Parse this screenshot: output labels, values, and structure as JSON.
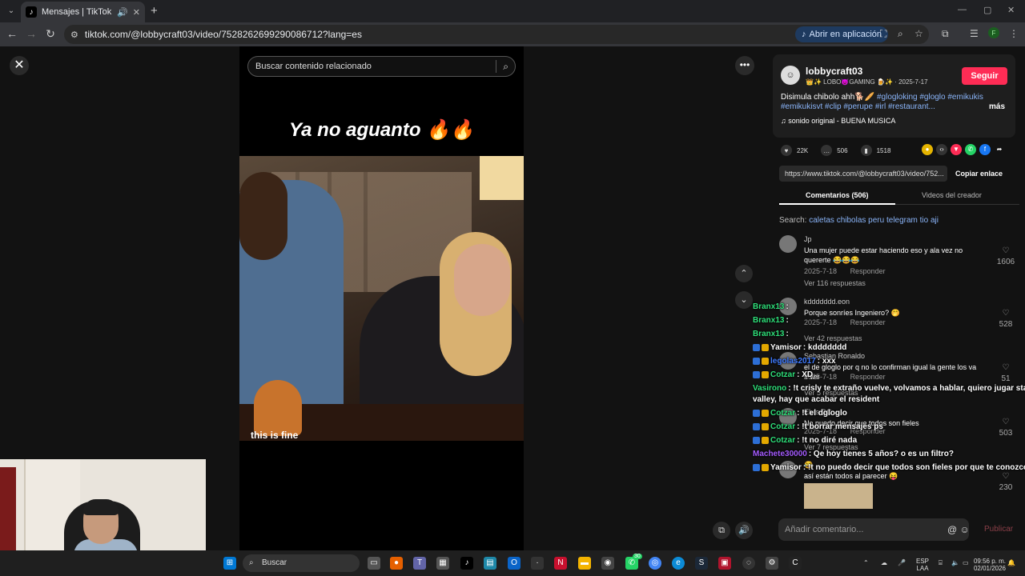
{
  "browser": {
    "tab_title": "Mensajes | TikTok",
    "url": "tiktok.com/@lobbycraft03/video/7528262699290086712?lang=es",
    "open_in_app": "Abrir en aplicación",
    "profile_letter": "F"
  },
  "video": {
    "search_placeholder": "Buscar contenido relacionado",
    "caption": "Ya no aguanto 🔥🔥",
    "meme_text": "this is fine"
  },
  "post": {
    "username": "lobbycraft03",
    "nickname": "👑✨ LOBO😈GAMING 🍺✨",
    "date": "2025-7-17",
    "follow_label": "Seguir",
    "description": "Disimula chibolo ahh🐕🥖",
    "tags": "#glogloking #gloglo #emikukis #emikukisvt #clip #perupe #irl #restaurant...",
    "more_label": "más",
    "sound": "sonido original - BUENA MUSICA",
    "likes": "22K",
    "comments": "506",
    "saves": "1518",
    "link": "https://www.tiktok.com/@lobbycraft03/video/752...",
    "copy_link": "Copiar enlace",
    "tab_comments": "Comentarios (506)",
    "tab_creator": "Videos del creador",
    "search_prefix": "Search:",
    "search_query": "caletas chibolas peru telegram tio aji",
    "add_comment_placeholder": "Añadir comentario...",
    "publish_label": "Publicar"
  },
  "comments": [
    {
      "user": "Jp",
      "text": "Una mujer puede estar haciendo eso y ala vez no quererte 😂😂😂",
      "date": "2025-7-18",
      "reply": "Responder",
      "more": "Ver 116 respuestas",
      "likes": "1606"
    },
    {
      "user": "kddddddd.eon",
      "text": "Porque sonríes Ingeniero? 🤭",
      "date": "2025-7-18",
      "reply": "Responder",
      "more": "Ver 42 respuestas",
      "likes": "528"
    },
    {
      "user": "Sebastian Ronaldo",
      "text": "el de gloglo por q no lo confirman igual la gente los va s ver",
      "date": "2025-7-18",
      "reply": "Responder",
      "more": "Ver 5 respuestas",
      "likes": "51"
    },
    {
      "user": "Elvis DC",
      "text": "No puedo decir que todos son fieles",
      "date": "2025-7-18",
      "reply": "Responder",
      "more": "Ver 7 respuestas",
      "likes": "503"
    },
    {
      "user": "😂",
      "text": "así están todos al parecer 😝",
      "likes": "230"
    }
  ],
  "chat": [
    {
      "name": "Branx13",
      "color": "#2fe07a",
      "text": ":",
      "badges": 0
    },
    {
      "name": "Branx13",
      "color": "#2fe07a",
      "text": ":",
      "badges": 0
    },
    {
      "name": "Branx13",
      "color": "#2fe07a",
      "text": ":",
      "badges": 0
    },
    {
      "name": "Yamisor",
      "color": "#ffffff",
      "text": ": kddddddd",
      "badges": 1
    },
    {
      "name": "legolas2017",
      "color": "#3f7bff",
      "text": ": xxx",
      "badges": 2
    },
    {
      "name": "Cotzar",
      "color": "#2fe07a",
      "text": ": XD",
      "badges": 2
    },
    {
      "name": "Vasirono",
      "color": "#2fe07a",
      "text": ": !t crisly te extraño vuelve, volvamos a hablar, quiero jugar stardew",
      "badges": 0
    },
    {
      "name": "",
      "color": "#ffffff",
      "text": "valley, hay que acabar el resident",
      "badges": 0
    },
    {
      "name": "Cotzar",
      "color": "#2fe07a",
      "text": ": !t el dgloglo",
      "badges": 2
    },
    {
      "name": "Cotzar",
      "color": "#2fe07a",
      "text": ": !t borrar mensajes ps",
      "badges": 2
    },
    {
      "name": "Cotzar",
      "color": "#2fe07a",
      "text": ": !t no diré nada",
      "badges": 2
    },
    {
      "name": "Machete30000",
      "color": "#a55cff",
      "text": ": Qe hoy tienes 5 años? o es un filtro?",
      "badges": 0
    },
    {
      "name": "Yamisor",
      "color": "#ffffff",
      "text": ": !t no puedo decir que todos son fieles por que te conozco boytito",
      "badges": 1
    }
  ],
  "taskbar": {
    "search_label": "Buscar",
    "lang": "ESP",
    "lang2": "LAA",
    "time": "09:56 p. m.",
    "date": "02/01/2026",
    "whatsapp_badge": "30"
  }
}
